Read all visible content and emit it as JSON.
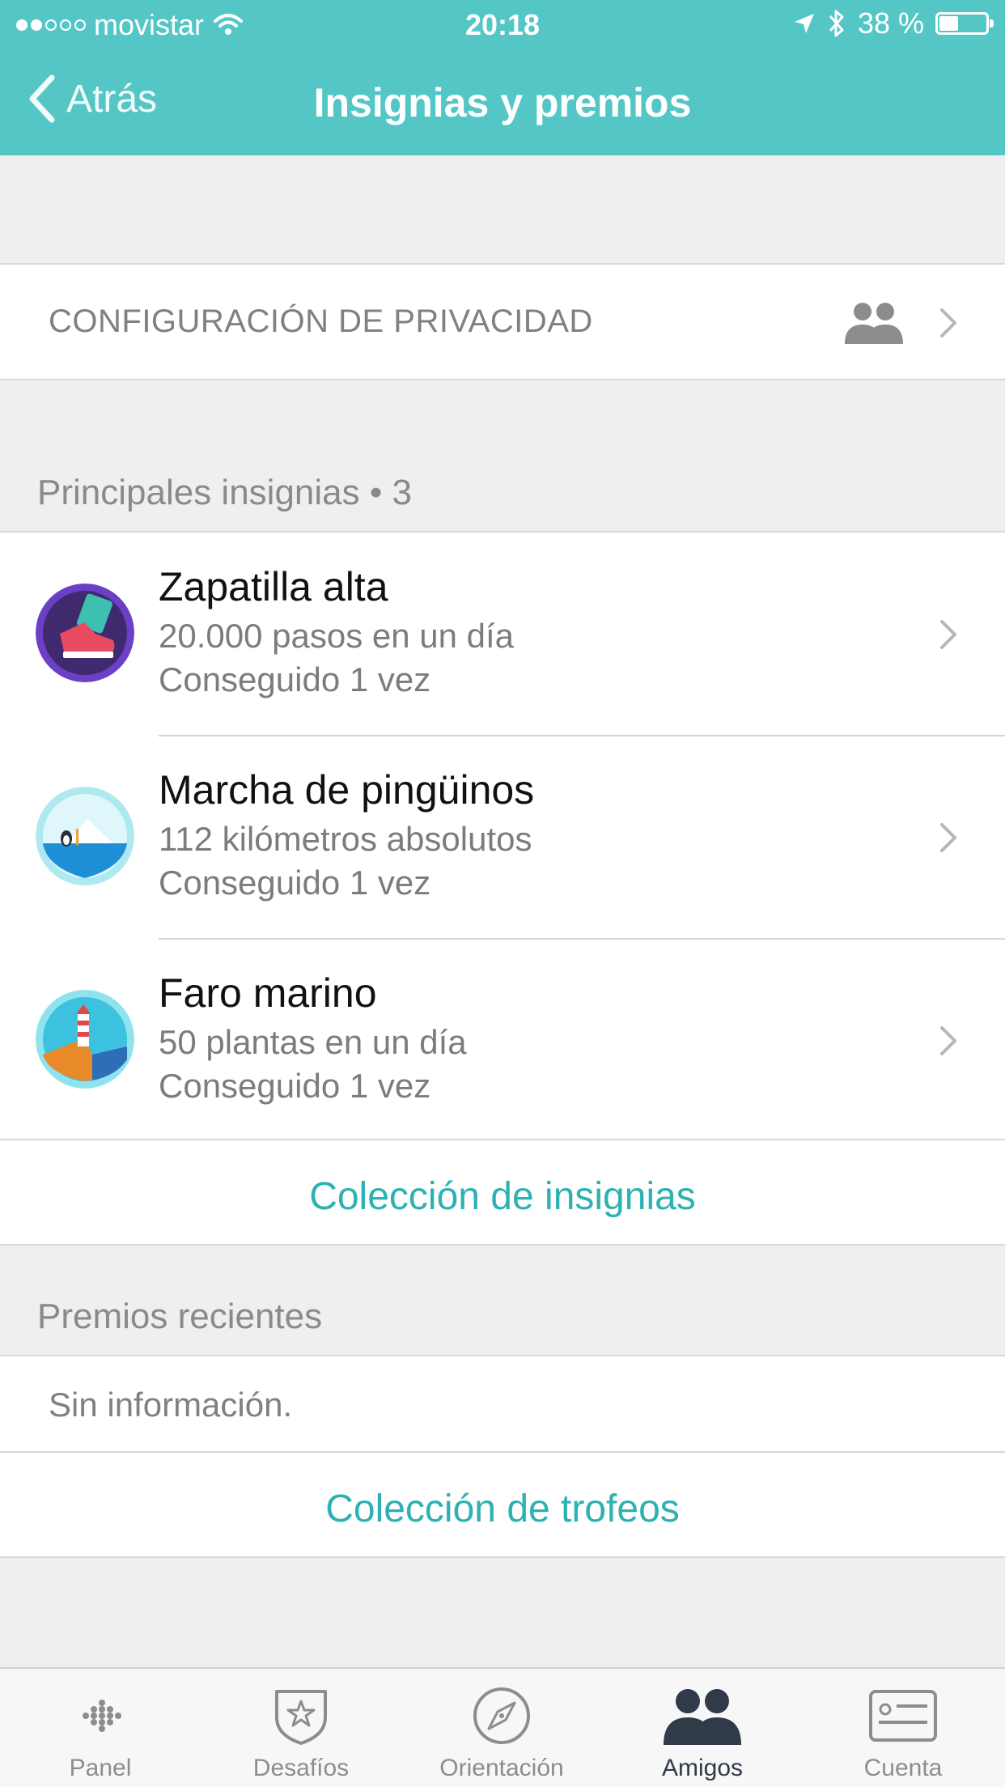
{
  "statusbar": {
    "carrier": "movistar",
    "time": "20:18",
    "battery": "38 %",
    "battery_level": 0.38
  },
  "navbar": {
    "back_label": "Atrás",
    "title": "Insignias y premios"
  },
  "privacy": {
    "label": "CONFIGURACIÓN DE PRIVACIDAD",
    "icon": "friends-icon"
  },
  "badges_section": {
    "header": "Principales insignias • 3",
    "items": [
      {
        "title": "Zapatilla alta",
        "desc": "20.000 pasos en un día",
        "count": "Conseguido 1 vez",
        "icon": "sneaker-badge-icon"
      },
      {
        "title": "Marcha de pingüinos",
        "desc": "112 kilómetros absolutos",
        "count": "Conseguido 1 vez",
        "icon": "penguin-badge-icon"
      },
      {
        "title": "Faro marino",
        "desc": "50 plantas en un día",
        "count": "Conseguido 1 vez",
        "icon": "lighthouse-badge-icon"
      }
    ],
    "link": "Colección de insignias"
  },
  "awards_section": {
    "header": "Premios recientes",
    "empty": "Sin información.",
    "link": "Colección de trofeos"
  },
  "tabbar": {
    "tabs": [
      {
        "label": "Panel",
        "icon": "dots-logo-icon"
      },
      {
        "label": "Desafíos",
        "icon": "star-shield-icon"
      },
      {
        "label": "Orientación",
        "icon": "compass-icon"
      },
      {
        "label": "Amigos",
        "icon": "friends-icon"
      },
      {
        "label": "Cuenta",
        "icon": "id-card-icon"
      }
    ],
    "active": "Amigos"
  },
  "colors": {
    "header": "#55c6c6",
    "link": "#2db1b1",
    "active_tab": "#303a48"
  }
}
